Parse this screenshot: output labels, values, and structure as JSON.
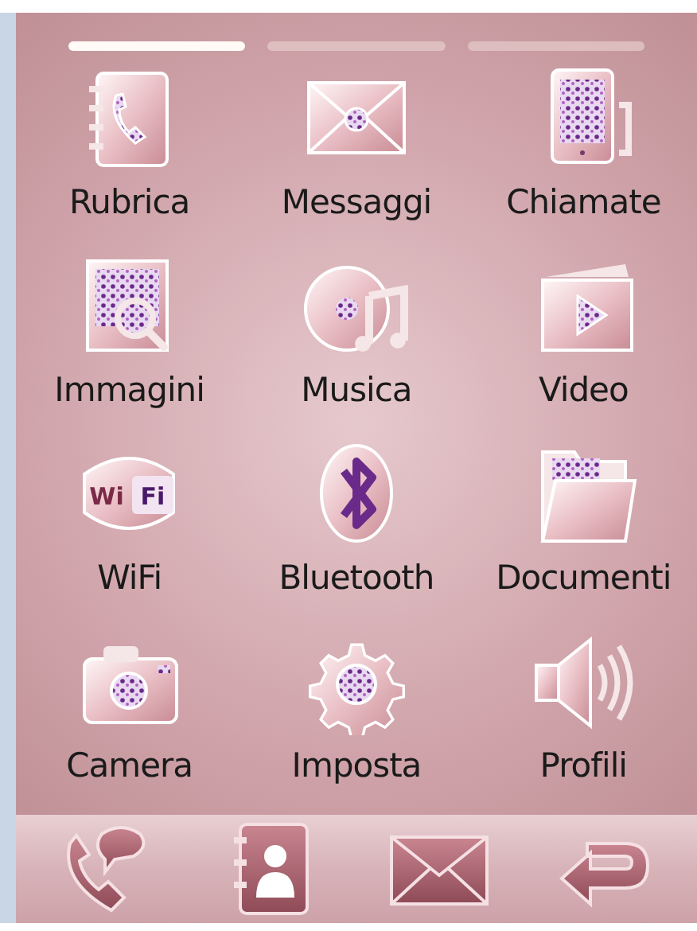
{
  "page_indicators": [
    {
      "selected": true
    },
    {
      "selected": false
    },
    {
      "selected": false
    }
  ],
  "apps": [
    {
      "label": "Rubrica",
      "kind": "contacts"
    },
    {
      "label": "Messaggi",
      "kind": "envelope"
    },
    {
      "label": "Chiamate",
      "kind": "calls"
    },
    {
      "label": "Immagini",
      "kind": "images"
    },
    {
      "label": "Musica",
      "kind": "music"
    },
    {
      "label": "Video",
      "kind": "video"
    },
    {
      "label": "WiFi",
      "kind": "wifi",
      "icon_text": [
        "Wi",
        "Fi"
      ]
    },
    {
      "label": "Bluetooth",
      "kind": "bluetooth"
    },
    {
      "label": "Documenti",
      "kind": "folder"
    },
    {
      "label": "Camera",
      "kind": "camera"
    },
    {
      "label": "Imposta",
      "kind": "gear"
    },
    {
      "label": "Profili",
      "kind": "speaker"
    }
  ],
  "dock": [
    {
      "kind": "call"
    },
    {
      "kind": "contact"
    },
    {
      "kind": "message"
    },
    {
      "kind": "back"
    }
  ]
}
